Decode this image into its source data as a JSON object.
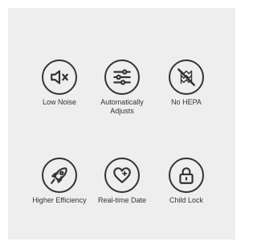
{
  "features": [
    {
      "label": "Low Noise",
      "icon": "speaker-mute-icon"
    },
    {
      "label": "Automatically\nAdjusts",
      "icon": "sliders-icon"
    },
    {
      "label": "No HEPA",
      "icon": "no-hepa-filter-icon"
    },
    {
      "label": "Higher Efficiency",
      "icon": "rocket-icon"
    },
    {
      "label": "Real-time Date",
      "icon": "heart-plus-icon"
    },
    {
      "label": "Child Lock",
      "icon": "padlock-icon"
    }
  ]
}
